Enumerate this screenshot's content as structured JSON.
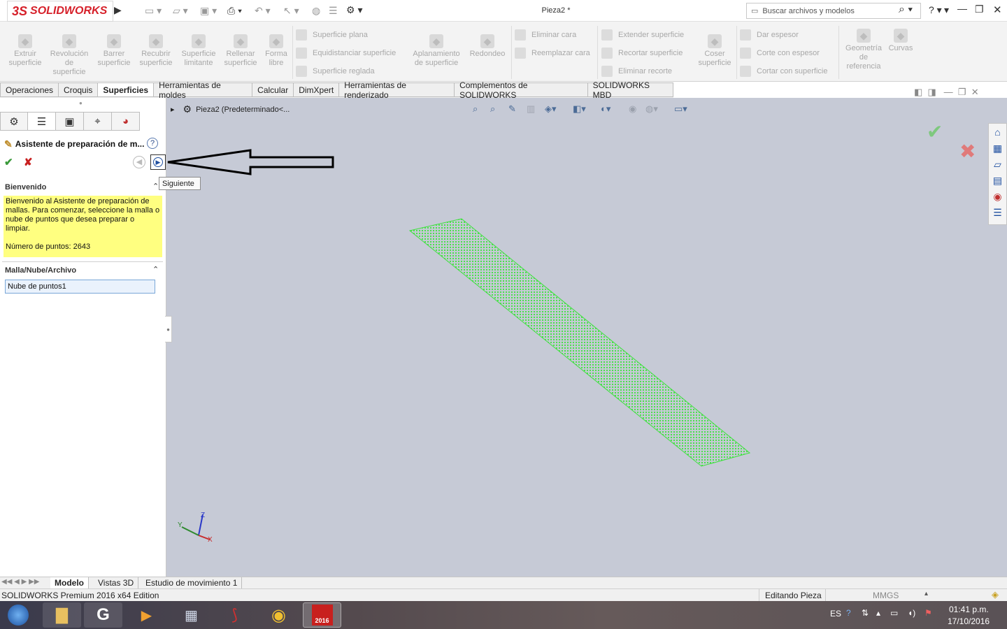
{
  "app": {
    "logo_text": "SOLIDWORKS",
    "logo_prefix": "3S",
    "doc_title": "Pieza2 *"
  },
  "search": {
    "placeholder": "Buscar archivos y modelos"
  },
  "commands": {
    "large": [
      {
        "label": "Extruir superficie"
      },
      {
        "label": "Revolución de superficie"
      },
      {
        "label": "Barrer superficie"
      },
      {
        "label": "Recubrir superficie"
      },
      {
        "label": "Superficie limitante"
      },
      {
        "label": "Rellenar superficie"
      },
      {
        "label": "Forma libre"
      },
      {
        "label": "Aplanamiento de superficie"
      },
      {
        "label": "Redondeo"
      },
      {
        "label": "Coser superficie"
      },
      {
        "label": "Geometría de referencia"
      },
      {
        "label": "Curvas"
      }
    ],
    "group1": [
      "Superficie plana",
      "Equidistanciar superficie",
      "Superficie reglada"
    ],
    "group2": [
      "Eliminar cara",
      "Reemplazar cara"
    ],
    "group3": [
      "Extender superficie",
      "Recortar superficie",
      "Eliminar recorte"
    ],
    "group4": [
      "Dar espesor",
      "Corte con espesor",
      "Cortar con superficie"
    ]
  },
  "tabs": [
    "Operaciones",
    "Croquis",
    "Superficies",
    "Herramientas de moldes",
    "Calcular",
    "DimXpert",
    "Herramientas de renderizado",
    "Complementos de SOLIDWORKS",
    "SOLIDWORKS MBD"
  ],
  "active_tab": "Superficies",
  "property_manager": {
    "title": "Asistente de preparación de m...",
    "help": "?",
    "section_welcome": "Bienvenido",
    "welcome_text": "Bienvenido al Asistente de preparación de mallas. Para comenzar, seleccione la malla o nube de puntos que desea preparar o limpiar.",
    "points_count": "Número de puntos: 2643",
    "section_mesh": "Malla/Nube/Archivo",
    "selection_value": "Nube de puntos1",
    "tooltip_next": "Siguiente"
  },
  "viewport": {
    "breadcrumb": "Pieza2  (Predeterminado<...",
    "triad_x": "X",
    "triad_y": "Y",
    "triad_z": "Z",
    "cloud_color": "#3ee23e"
  },
  "model_tabs": [
    "Modelo",
    "Vistas 3D",
    "Estudio de movimiento 1"
  ],
  "status": {
    "edition": "SOLIDWORKS Premium 2016 x64 Edition",
    "mode": "Editando Pieza",
    "units": "MMGS"
  },
  "taskbar": {
    "lang": "ES",
    "time": "01:41 p.m.",
    "date": "17/10/2016",
    "sw_badge": "2016"
  }
}
